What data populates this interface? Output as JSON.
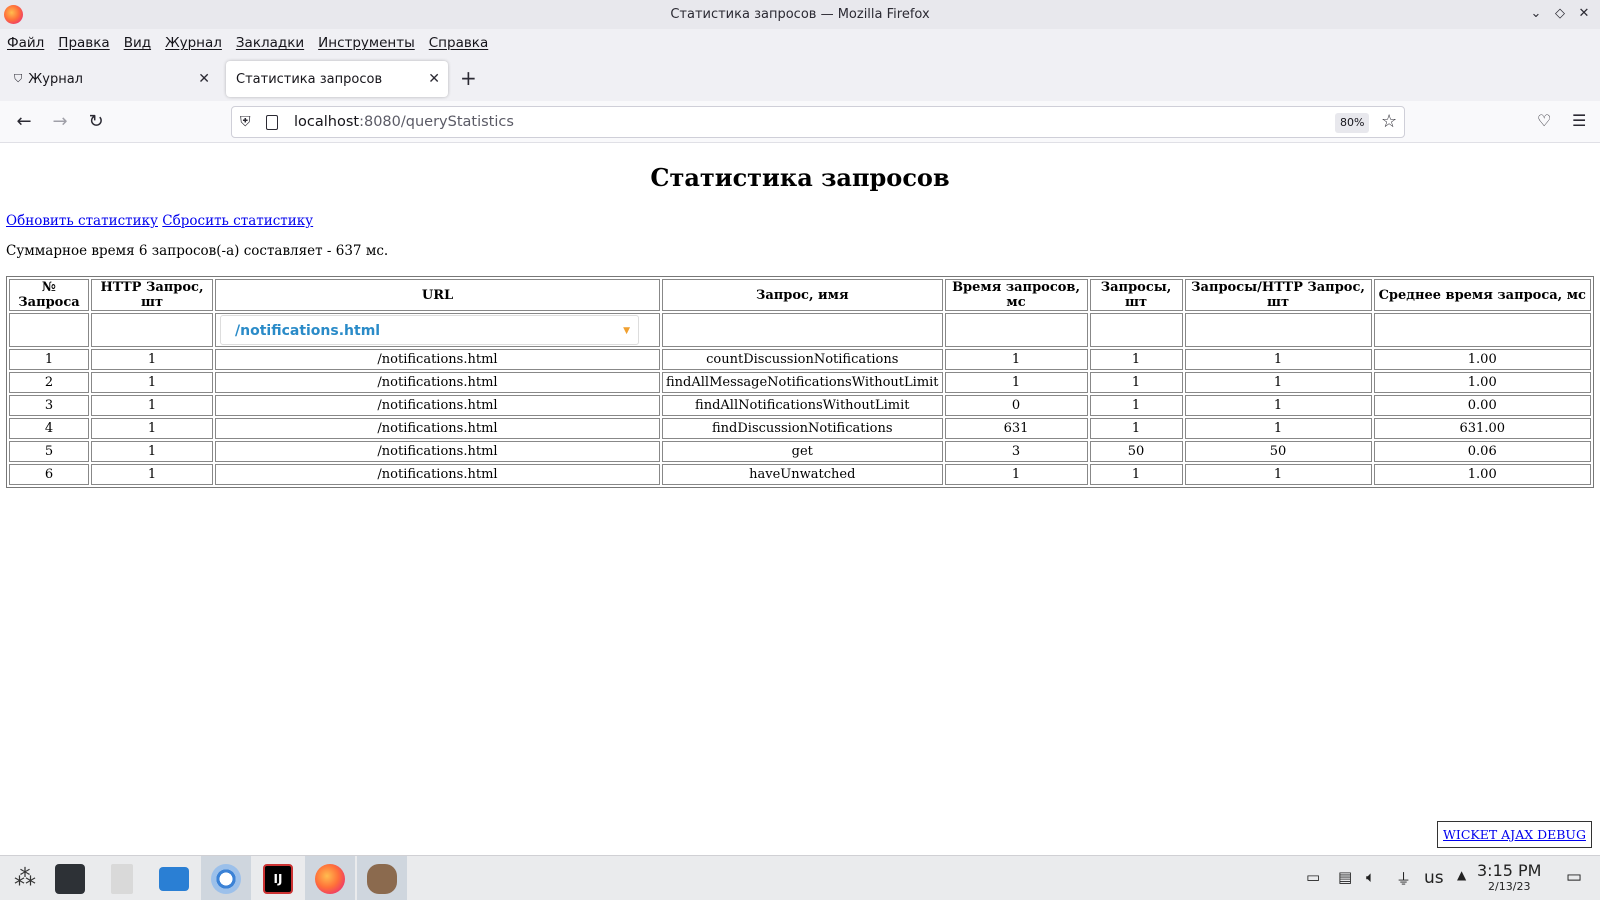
{
  "window": {
    "title": "Статистика запросов — Mozilla Firefox"
  },
  "menu": [
    "Файл",
    "Правка",
    "Вид",
    "Журнал",
    "Закладки",
    "Инструменты",
    "Справка"
  ],
  "tabs": [
    {
      "label": "Журнал",
      "active": false
    },
    {
      "label": "Статистика запросов",
      "active": true
    }
  ],
  "urlbar": {
    "host": "localhost",
    "rest": ":8080/queryStatistics",
    "zoom": "80%"
  },
  "page": {
    "title": "Статистика запросов",
    "refresh_link": "Обновить статистику",
    "reset_link": "Сбросить статистику",
    "summary": "Суммарное время 6 запросов(-а) составляет - 637 мс.",
    "url_filter": "/notifications.html",
    "columns": [
      "№ Запроса",
      "HTTP Запрос, шт",
      "URL",
      "Запрос, имя",
      "Время запросов, мс",
      "Запросы, шт",
      "Запросы/HTTP Запрос, шт",
      "Среднее время запроса, мс"
    ],
    "rows": [
      [
        "1",
        "1",
        "/notifications.html",
        "countDiscussionNotifications",
        "1",
        "1",
        "1",
        "1.00"
      ],
      [
        "2",
        "1",
        "/notifications.html",
        "findAllMessageNotificationsWithoutLimit",
        "1",
        "1",
        "1",
        "1.00"
      ],
      [
        "3",
        "1",
        "/notifications.html",
        "findAllNotificationsWithoutLimit",
        "0",
        "1",
        "1",
        "0.00"
      ],
      [
        "4",
        "1",
        "/notifications.html",
        "findDiscussionNotifications",
        "631",
        "1",
        "1",
        "631.00"
      ],
      [
        "5",
        "1",
        "/notifications.html",
        "get",
        "3",
        "50",
        "50",
        "0.06"
      ],
      [
        "6",
        "1",
        "/notifications.html",
        "haveUnwatched",
        "1",
        "1",
        "1",
        "1.00"
      ]
    ],
    "debug_link": "WICKET AJAX DEBUG"
  },
  "taskbar": {
    "keyboard_layout": "us",
    "time": "3:15 PM",
    "date": "2/13/23"
  },
  "colors": {
    "link": "#0000ee",
    "select_text": "#2a8bc8",
    "select_caret": "#f0a030"
  }
}
